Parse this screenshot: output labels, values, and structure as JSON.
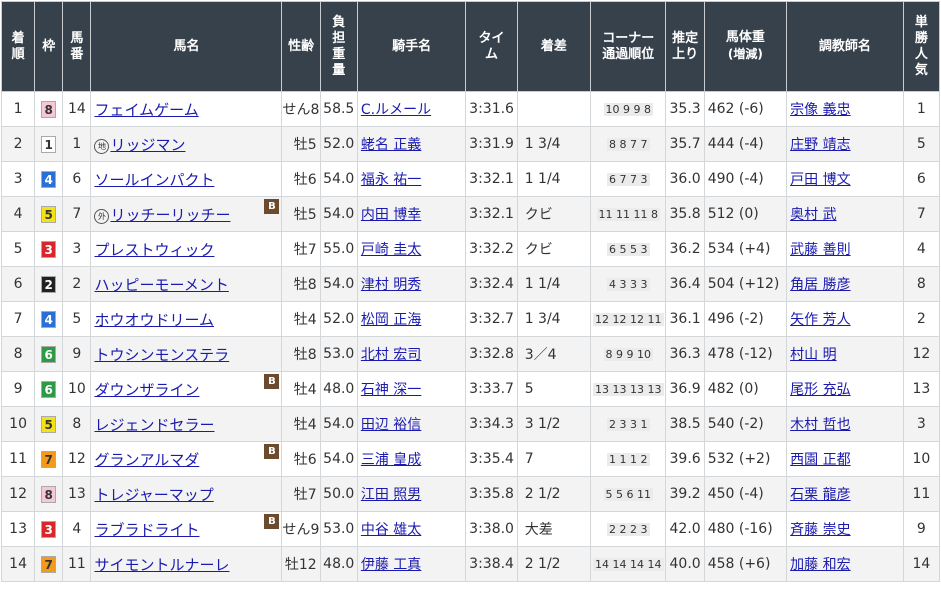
{
  "headers": {
    "rank": "着順",
    "waku": "枠",
    "umaban": "馬番",
    "horse": "馬名",
    "sexage": "性齢",
    "weight": "負担重量",
    "jockey": "騎手名",
    "time": "タイム",
    "margin": "着差",
    "corner_l1": "コーナー",
    "corner_l2": "通過順位",
    "last3f": "推定上り",
    "body_l1": "馬体重",
    "body_l2": "(増減)",
    "trainer": "調教師名",
    "pop": "単勝人気"
  },
  "waku_colors": {
    "1": {
      "bg": "#ffffff",
      "fg": "#333333"
    },
    "2": {
      "bg": "#222222",
      "fg": "#ffffff"
    },
    "3": {
      "bg": "#d7262c",
      "fg": "#ffffff"
    },
    "4": {
      "bg": "#2a6fd6",
      "fg": "#ffffff"
    },
    "5": {
      "bg": "#f3e21a",
      "fg": "#333333"
    },
    "6": {
      "bg": "#2e9a46",
      "fg": "#ffffff"
    },
    "7": {
      "bg": "#f39a1c",
      "fg": "#333333"
    },
    "8": {
      "bg": "#f6c8d6",
      "fg": "#333333"
    }
  },
  "rows": [
    {
      "rank": "1",
      "waku": "8",
      "umaban": "14",
      "mark": "",
      "horse": "フェイムゲーム",
      "blinker": "",
      "sexage": "せん8",
      "weight": "58.5",
      "jockey": "C.ルメール",
      "time": "3:31.6",
      "margin": "",
      "corner": "10 9 9 8",
      "last3f": "35.3",
      "body": "462 (-6)",
      "trainer": "宗像 義忠",
      "pop": "1"
    },
    {
      "rank": "2",
      "waku": "1",
      "umaban": "1",
      "mark": "地",
      "horse": "リッジマン",
      "blinker": "",
      "sexage": "牡5",
      "weight": "52.0",
      "jockey": "蛯名 正義",
      "time": "3:31.9",
      "margin": "1 3/4",
      "corner": "8 8 7 7",
      "last3f": "35.7",
      "body": "444 (-4)",
      "trainer": "庄野 靖志",
      "pop": "5"
    },
    {
      "rank": "3",
      "waku": "4",
      "umaban": "6",
      "mark": "",
      "horse": "ソールインパクト",
      "blinker": "",
      "sexage": "牡6",
      "weight": "54.0",
      "jockey": "福永 祐一",
      "time": "3:32.1",
      "margin": "1 1/4",
      "corner": "6 7 7 3",
      "last3f": "36.0",
      "body": "490 (-4)",
      "trainer": "戸田 博文",
      "pop": "6"
    },
    {
      "rank": "4",
      "waku": "5",
      "umaban": "7",
      "mark": "外",
      "horse": "リッチーリッチー",
      "blinker": "B",
      "sexage": "牡5",
      "weight": "54.0",
      "jockey": "内田 博幸",
      "time": "3:32.1",
      "margin": "クビ",
      "corner": "11 11 11 8",
      "last3f": "35.8",
      "body": "512 (0)",
      "trainer": "奥村 武",
      "pop": "7"
    },
    {
      "rank": "5",
      "waku": "3",
      "umaban": "3",
      "mark": "",
      "horse": "プレストウィック",
      "blinker": "",
      "sexage": "牡7",
      "weight": "55.0",
      "jockey": "戸崎 圭太",
      "time": "3:32.2",
      "margin": "クビ",
      "corner": "6 5 5 3",
      "last3f": "36.2",
      "body": "534 (+4)",
      "trainer": "武藤 善則",
      "pop": "4"
    },
    {
      "rank": "6",
      "waku": "2",
      "umaban": "2",
      "mark": "",
      "horse": "ハッピーモーメント",
      "blinker": "",
      "sexage": "牡8",
      "weight": "54.0",
      "jockey": "津村 明秀",
      "time": "3:32.4",
      "margin": "1 1/4",
      "corner": "4 3 3 3",
      "last3f": "36.4",
      "body": "504 (+12)",
      "trainer": "角居 勝彦",
      "pop": "8"
    },
    {
      "rank": "7",
      "waku": "4",
      "umaban": "5",
      "mark": "",
      "horse": "ホウオウドリーム",
      "blinker": "",
      "sexage": "牡4",
      "weight": "52.0",
      "jockey": "松岡 正海",
      "time": "3:32.7",
      "margin": "1 3/4",
      "corner": "12 12 12 11",
      "last3f": "36.1",
      "body": "496 (-2)",
      "trainer": "矢作 芳人",
      "pop": "2"
    },
    {
      "rank": "8",
      "waku": "6",
      "umaban": "9",
      "mark": "",
      "horse": "トウシンモンステラ",
      "blinker": "",
      "sexage": "牡8",
      "weight": "53.0",
      "jockey": "北村 宏司",
      "time": "3:32.8",
      "margin": "3／4",
      "corner": "8 9 9 10",
      "last3f": "36.3",
      "body": "478 (-12)",
      "trainer": "村山 明",
      "pop": "12"
    },
    {
      "rank": "9",
      "waku": "6",
      "umaban": "10",
      "mark": "",
      "horse": "ダウンザライン",
      "blinker": "B",
      "sexage": "牡4",
      "weight": "48.0",
      "jockey": "石神 深一",
      "time": "3:33.7",
      "margin": "5",
      "corner": "13 13 13 13",
      "last3f": "36.9",
      "body": "482 (0)",
      "trainer": "尾形 充弘",
      "pop": "13"
    },
    {
      "rank": "10",
      "waku": "5",
      "umaban": "8",
      "mark": "",
      "horse": "レジェンドセラー",
      "blinker": "",
      "sexage": "牡4",
      "weight": "54.0",
      "jockey": "田辺 裕信",
      "time": "3:34.3",
      "margin": "3 1/2",
      "corner": "2 3 3 1",
      "last3f": "38.5",
      "body": "540 (-2)",
      "trainer": "木村 哲也",
      "pop": "3"
    },
    {
      "rank": "11",
      "waku": "7",
      "umaban": "12",
      "mark": "",
      "horse": "グランアルマダ",
      "blinker": "B",
      "sexage": "牡6",
      "weight": "54.0",
      "jockey": "三浦 皇成",
      "time": "3:35.4",
      "margin": "7",
      "corner": "1 1 1 2",
      "last3f": "39.6",
      "body": "532 (+2)",
      "trainer": "西園 正都",
      "pop": "10"
    },
    {
      "rank": "12",
      "waku": "8",
      "umaban": "13",
      "mark": "",
      "horse": "トレジャーマップ",
      "blinker": "",
      "sexage": "牡7",
      "weight": "50.0",
      "jockey": "江田 照男",
      "time": "3:35.8",
      "margin": "2 1/2",
      "corner": "5 5 6 11",
      "last3f": "39.2",
      "body": "450 (-4)",
      "trainer": "石栗 龍彦",
      "pop": "11"
    },
    {
      "rank": "13",
      "waku": "3",
      "umaban": "4",
      "mark": "",
      "horse": "ラブラドライト",
      "blinker": "B",
      "sexage": "せん9",
      "weight": "53.0",
      "jockey": "中谷 雄太",
      "time": "3:38.0",
      "margin": "大差",
      "corner": "2 2 2 3",
      "last3f": "42.0",
      "body": "480 (-16)",
      "trainer": "斉藤 崇史",
      "pop": "9"
    },
    {
      "rank": "14",
      "waku": "7",
      "umaban": "11",
      "mark": "",
      "horse": "サイモントルナーレ",
      "blinker": "",
      "sexage": "牡12",
      "weight": "48.0",
      "jockey": "伊藤 工真",
      "time": "3:38.4",
      "margin": "2 1/2",
      "corner": "14 14 14 14",
      "last3f": "40.0",
      "body": "458 (+6)",
      "trainer": "加藤 和宏",
      "pop": "14"
    }
  ]
}
